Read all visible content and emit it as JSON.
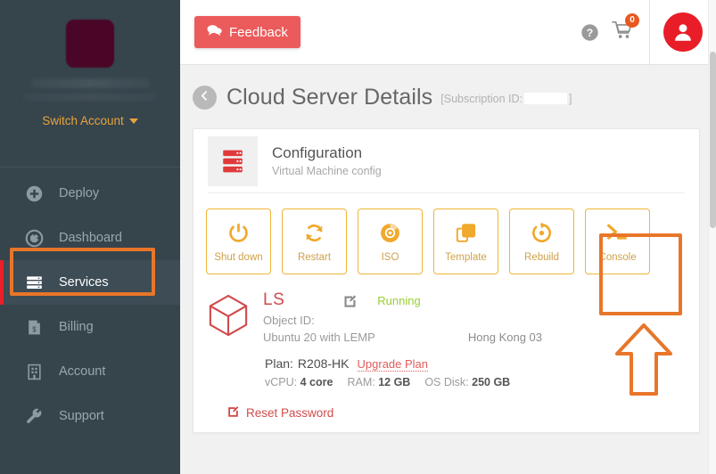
{
  "sidebar": {
    "brand_logo_redacted": true,
    "brand_name_redacted": true,
    "switch_account_label": "Switch Account",
    "items": [
      {
        "label": "Deploy",
        "icon": "plus-circle-icon",
        "active": false
      },
      {
        "label": "Dashboard",
        "icon": "gauge-icon",
        "active": false
      },
      {
        "label": "Services",
        "icon": "server-stack-icon",
        "active": true
      },
      {
        "label": "Billing",
        "icon": "invoice-icon",
        "active": false
      },
      {
        "label": "Account",
        "icon": "building-icon",
        "active": false
      },
      {
        "label": "Support",
        "icon": "wrench-icon",
        "active": false
      }
    ]
  },
  "topbar": {
    "feedback_label": "Feedback",
    "feedback_icon": "chat-bubble-icon",
    "help_icon": "question-circle-icon",
    "cart_icon": "shopping-cart-icon",
    "cart_count": "0",
    "avatar_icon": "user-avatar-icon"
  },
  "page": {
    "back_icon": "chevron-left-icon",
    "title": "Cloud Server Details",
    "subscription_prefix": "[Subscription ID:",
    "subscription_value": "",
    "subscription_suffix": "]"
  },
  "config_card": {
    "icon": "server-rack-icon",
    "title": "Configuration",
    "subtitle": "Virtual Machine config",
    "actions": [
      {
        "label": "Shut down",
        "icon": "power-icon"
      },
      {
        "label": "Restart",
        "icon": "refresh-icon"
      },
      {
        "label": "ISO",
        "icon": "disc-icon"
      },
      {
        "label": "Template",
        "icon": "copy-squares-icon"
      },
      {
        "label": "Rebuild",
        "icon": "rebuild-circle-icon"
      },
      {
        "label": "Console",
        "icon": "terminal-prompt-icon"
      }
    ],
    "server": {
      "cube_icon": "cube-icon",
      "name": "LS",
      "edit_icon": "edit-pencil-icon",
      "status": "Running",
      "object_id_label": "Object ID:",
      "object_id_value": "",
      "os": "Ubuntu 20 with LEMP",
      "region": "Hong Kong 03",
      "plan_label": "Plan:",
      "plan_value": "R208-HK",
      "upgrade_link": "Upgrade Plan",
      "specs": [
        {
          "label": "vCPU:",
          "value": "4 core"
        },
        {
          "label": "RAM:",
          "value": "12 GB"
        },
        {
          "label": "OS Disk:",
          "value": "250 GB"
        }
      ],
      "reset_password_label": "Reset Password",
      "reset_password_icon": "edit-pencil-icon"
    }
  },
  "annotations": {
    "highlight_color": "#e8762a",
    "services_box": "highlight-services-nav",
    "console_box": "highlight-console-button",
    "arrow": "up-arrow-pointing-to-console"
  },
  "colors": {
    "sidebar_bg": "#36444c",
    "accent_amber": "#f0b537",
    "brand_red": "#e81d28",
    "status_green": "#9acd32",
    "annotation_orange": "#e8762a"
  }
}
